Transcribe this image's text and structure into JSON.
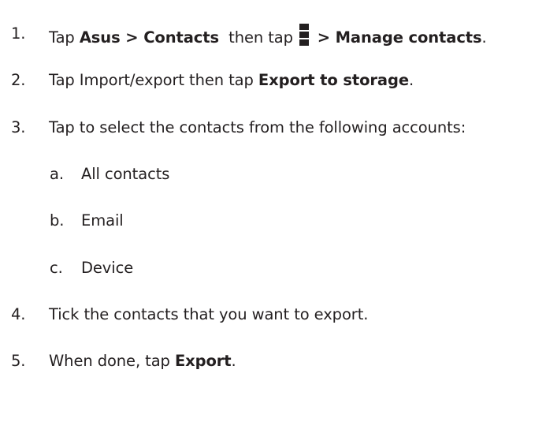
{
  "steps": [
    {
      "number": "1.",
      "text_a": "Tap ",
      "bold_a": "Asus > Contacts",
      "text_b": "  then tap ",
      "icon": "vertical-ellipsis-menu-icon",
      "bold_b": " > Manage contacts",
      "text_c": "."
    },
    {
      "number": "2.",
      "text_a": "Tap Import/export then tap ",
      "bold_a": "Export to storage",
      "text_b": "."
    },
    {
      "number": "3.",
      "text_a": "Tap to select the contacts from the following accounts:"
    },
    {
      "number": "4.",
      "text_a": "Tick the contacts that you want to export."
    },
    {
      "number": "5.",
      "text_a": "When done, tap ",
      "bold_a": "Export",
      "text_b": "."
    }
  ],
  "substeps": [
    {
      "letter": "a.",
      "text": "All contacts"
    },
    {
      "letter": "b.",
      "text": "Email"
    },
    {
      "letter": "c.",
      "text": "Device"
    }
  ]
}
